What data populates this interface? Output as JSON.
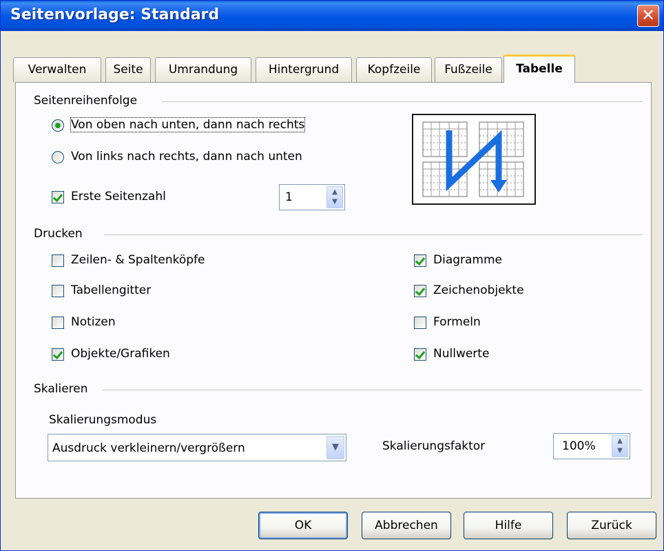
{
  "window": {
    "title": "Seitenvorlage: Standard",
    "close_glyph": "✕"
  },
  "tabs": [
    {
      "label": "Verwalten"
    },
    {
      "label": "Seite"
    },
    {
      "label": "Umrandung"
    },
    {
      "label": "Hintergrund"
    },
    {
      "label": "Kopfzeile"
    },
    {
      "label": "Fußzeile"
    },
    {
      "label": "Tabelle"
    }
  ],
  "active_tab": "Tabelle",
  "page_order": {
    "title": "Seitenreihenfolge",
    "options": [
      {
        "label": "Von oben nach unten, dann nach rechts",
        "selected": true
      },
      {
        "label": "Von links nach rechts, dann nach unten",
        "selected": false
      }
    ],
    "first_page": {
      "label": "Erste Seitenzahl",
      "checked": true,
      "value": "1"
    }
  },
  "print": {
    "title": "Drucken",
    "left": [
      {
        "label": "Zeilen- & Spaltenköpfe",
        "checked": false
      },
      {
        "label": "Tabellengitter",
        "checked": false
      },
      {
        "label": "Notizen",
        "checked": false
      },
      {
        "label": "Objekte/Grafiken",
        "checked": true
      }
    ],
    "right": [
      {
        "label": "Diagramme",
        "checked": true
      },
      {
        "label": "Zeichenobjekte",
        "checked": true
      },
      {
        "label": "Formeln",
        "checked": false
      },
      {
        "label": "Nullwerte",
        "checked": true
      }
    ]
  },
  "scale": {
    "title": "Skalieren",
    "mode_label": "Skalierungsmodus",
    "mode_value": "Ausdruck verkleinern/vergrößern",
    "factor_label": "Skalierungsfaktor",
    "factor_value": "100%"
  },
  "buttons": {
    "ok": "OK",
    "cancel": "Abbrechen",
    "help": "Hilfe",
    "reset": "Zurück"
  },
  "colors": {
    "titlebar": "#0055e5",
    "active_tab_accent": "#ffc83c",
    "check_green": "#21a121",
    "arrow_blue": "#1a6fe0"
  }
}
